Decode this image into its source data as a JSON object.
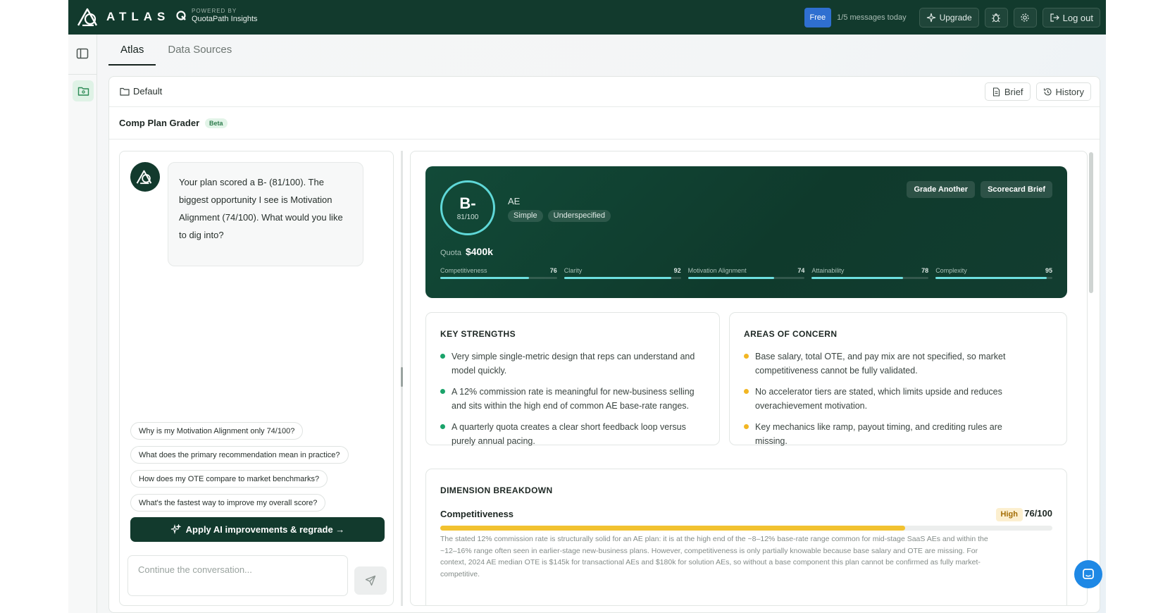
{
  "brand": {
    "name": "ATLAS",
    "powered_by": "POWERED BY",
    "partner": "QuotaPath Insights"
  },
  "topbar": {
    "plan_badge": "Free",
    "message_count": "1/5 messages today",
    "upgrade_label": "Upgrade",
    "logout_label": "Log out"
  },
  "tabs": [
    {
      "label": "Atlas"
    },
    {
      "label": "Data Sources"
    }
  ],
  "header": {
    "folder": "Default",
    "brief_label": "Brief",
    "history_label": "History"
  },
  "grader": {
    "title": "Comp Plan Grader",
    "badge": "Beta"
  },
  "chat": {
    "message": "Your plan scored a B- (81/100). The biggest opportunity I see is Motivation Alignment (74/100). What would you like to dig into?",
    "suggestions": [
      "Why is my Motivation Alignment only 74/100?",
      "What does the primary recommendation mean in practice?",
      "How does my OTE compare to market benchmarks?",
      "What's the fastest way to improve my overall score?"
    ],
    "apply_label": "Apply AI improvements & regrade →",
    "input_placeholder": "Continue the conversation..."
  },
  "scorecard": {
    "grade": "B-",
    "score": "81/100",
    "role": "AE",
    "tags": [
      "Simple",
      "Underspecified"
    ],
    "grade_another_label": "Grade Another",
    "brief_label": "Scorecard Brief",
    "quota_label": "Quota",
    "quota_value": "$400k",
    "metrics": [
      {
        "label": "Competitiveness",
        "value": 76
      },
      {
        "label": "Clarity",
        "value": 92
      },
      {
        "label": "Motivation Alignment",
        "value": 74
      },
      {
        "label": "Attainability",
        "value": 78
      },
      {
        "label": "Complexity",
        "value": 95
      }
    ],
    "accent_color": "#6ee0e0"
  },
  "strengths": {
    "title": "KEY STRENGTHS",
    "color": "#1aa36a",
    "items": [
      "Very simple single-metric design that reps can understand and model quickly.",
      "A 12% commission rate is meaningful for new-business selling and sits within the high end of common AE base-rate ranges.",
      "A quarterly quota creates a clear short feedback loop versus purely annual pacing."
    ]
  },
  "concerns": {
    "title": "AREAS OF CONCERN",
    "color": "#f2b623",
    "items": [
      "Base salary, total OTE, and pay mix are not specified, so market competitiveness cannot be fully validated.",
      "No accelerator tiers are stated, which limits upside and reduces overachievement motivation.",
      "Key mechanics like ramp, payout timing, and crediting rules are missing."
    ]
  },
  "dimensions": {
    "title": "DIMENSION BREAKDOWN",
    "items": [
      {
        "name": "Competitiveness",
        "level": "High",
        "score_text": "76/100",
        "score": 76,
        "text": "The stated 12% commission rate is structurally solid for an AE plan: it is at the high end of the ~8–12% base-rate range common for mid-stage SaaS AEs and within the ~12–16% range often seen in earlier-stage new-business plans. However, competitiveness is only partially knowable because base salary and OTE are missing. For context, 2024 AE median OTE is $145k for transactional AEs and $180k for solution AEs, so without a base component this plan cannot be confirmed as fully market-competitive."
      }
    ]
  }
}
